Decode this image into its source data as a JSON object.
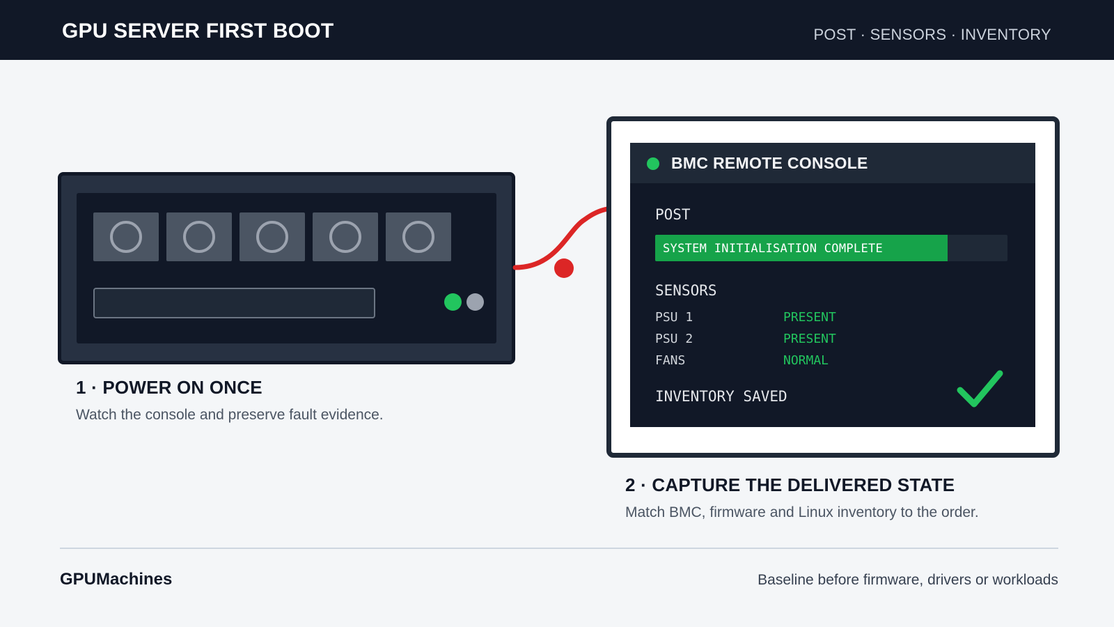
{
  "header": {
    "title": "GPU SERVER FIRST BOOT",
    "nav": "POST · SENSORS · INVENTORY"
  },
  "step1": {
    "title": "1 · POWER ON ONCE",
    "description": "Watch the console and preserve fault evidence."
  },
  "step2": {
    "title": "2 · CAPTURE THE DELIVERED STATE",
    "description": "Match BMC, firmware and Linux inventory to the order."
  },
  "console": {
    "title": "BMC REMOTE CONSOLE",
    "post_label": "POST",
    "post_status": "SYSTEM INITIALISATION COMPLETE",
    "post_progress": 0.83,
    "sensors_label": "SENSORS",
    "sensors": [
      {
        "name": "PSU 1",
        "value": "PRESENT"
      },
      {
        "name": "PSU 2",
        "value": "PRESENT"
      },
      {
        "name": "FANS",
        "value": "NORMAL"
      }
    ],
    "inventory_label": "INVENTORY SAVED"
  },
  "footer": {
    "brand": "GPUMachines",
    "tagline": "Baseline before firmware, drivers or workloads"
  },
  "colors": {
    "background": "#f4f6f8",
    "dark": "#111827",
    "accent_green": "#22c55e",
    "cable_red": "#dc2626"
  },
  "icons": [
    "drive-bay-icon",
    "status-led-icon",
    "power-cable-icon",
    "checkmark-icon"
  ]
}
